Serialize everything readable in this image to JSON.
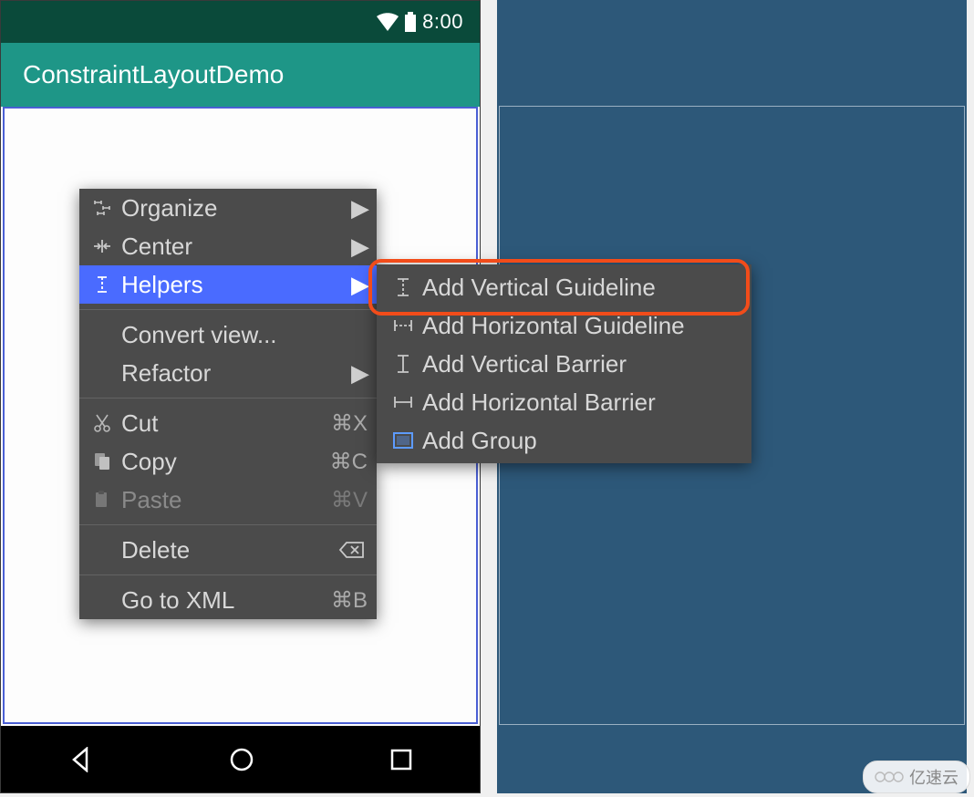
{
  "status": {
    "time": "8:00"
  },
  "app": {
    "title": "ConstraintLayoutDemo"
  },
  "menu": {
    "organize": "Organize",
    "center": "Center",
    "helpers": "Helpers",
    "convert": "Convert view...",
    "refactor": "Refactor",
    "cut": "Cut",
    "cut_sc": "⌘X",
    "copy": "Copy",
    "copy_sc": "⌘C",
    "paste": "Paste",
    "paste_sc": "⌘V",
    "delete": "Delete",
    "goto": "Go to XML",
    "goto_sc": "⌘B"
  },
  "submenu": {
    "add_v_guide": "Add Vertical Guideline",
    "add_h_guide": "Add Horizontal Guideline",
    "add_v_barrier": "Add Vertical Barrier",
    "add_h_barrier": "Add Horizontal Barrier",
    "add_group": "Add Group"
  },
  "watermark": "亿速云"
}
